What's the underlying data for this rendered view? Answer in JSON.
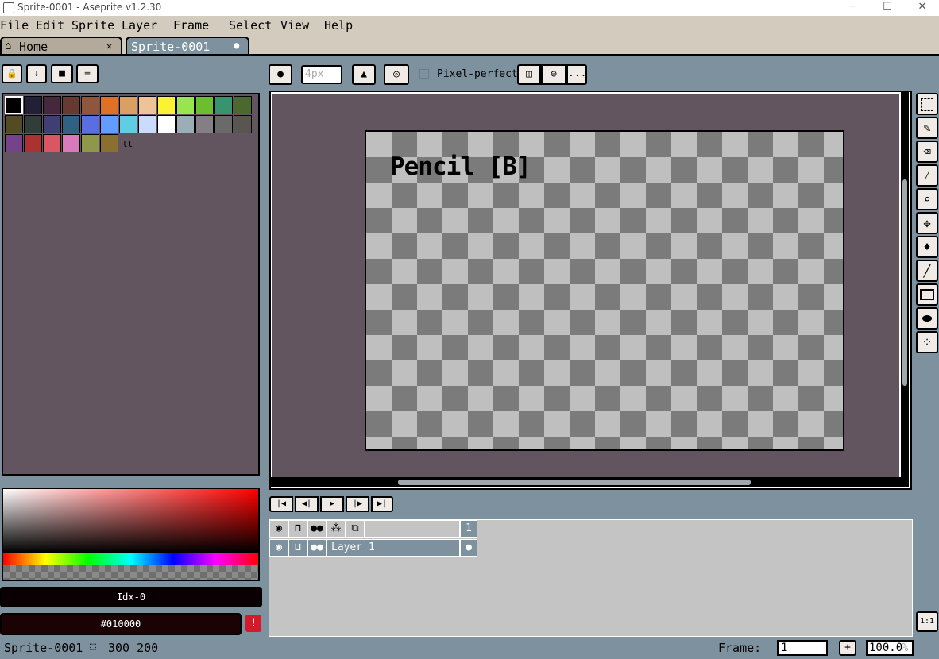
{
  "window": {
    "title": "Sprite-0001 - Aseprite v1.2.30",
    "minimize": "─",
    "maximize": "☐",
    "close": "✕"
  },
  "menu": [
    "File",
    "Edit",
    "Sprite",
    "Layer",
    "Frame",
    "Select",
    "View",
    "Help"
  ],
  "tabs": {
    "home": {
      "label": "Home",
      "close": "✕"
    },
    "sprite": {
      "label": "Sprite-0001",
      "dot": "●"
    }
  },
  "palette_toolbar": [
    "🔒",
    "↓",
    "■",
    "≡"
  ],
  "context_bar": {
    "brush_size": "4px",
    "pixel_perfect_label": "Pixel-perfect",
    "more": "..."
  },
  "palette": {
    "colors": [
      "#000000",
      "#222034",
      "#45283c",
      "#663931",
      "#8f563b",
      "#df7126",
      "#d9a066",
      "#eec39a",
      "#fbf236",
      "#99e550",
      "#6abe30",
      "#37946e",
      "#4b692f",
      "#524b24",
      "#323c39",
      "#3f3f74",
      "#306082",
      "#5b6ee1",
      "#639bff",
      "#5fcde4",
      "#cbdbfc",
      "#ffffff",
      "#9badb7",
      "#847e87",
      "#696a6a",
      "#595652",
      "#76428a",
      "#ac3232",
      "#d95763",
      "#d77bba",
      "#8f974a",
      "#8a6f30"
    ],
    "more": "ll"
  },
  "color_bar": {
    "index_label": "Idx-0",
    "hex_label": "#010000",
    "warning": "!"
  },
  "canvas": {
    "tooltip": "Pencil [B]"
  },
  "tools": [
    "rectangular-marquee",
    "pencil",
    "eraser",
    "eyedropper",
    "zoom",
    "move",
    "paint-bucket",
    "line",
    "rectangle",
    "contour",
    "spray"
  ],
  "timeline": {
    "frame_header": "1",
    "layer_name": "Layer 1"
  },
  "status": {
    "sprite_name": "Sprite-0001",
    "size": "300 200",
    "frame_label": "Frame:",
    "frame_value": "1",
    "add_frame": "+",
    "zoom": "100.0",
    "zoom_unit": "%",
    "one_to_one": "1:1"
  }
}
